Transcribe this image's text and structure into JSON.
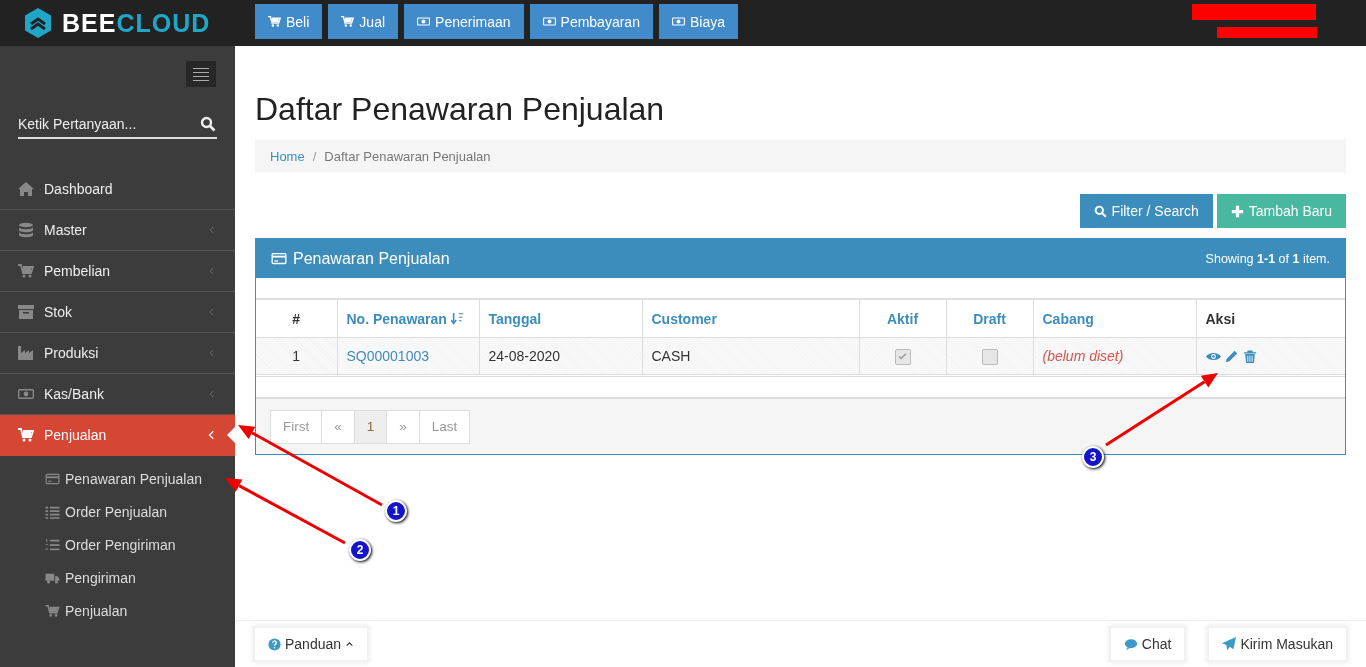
{
  "brand": {
    "name_part_1": "BEE",
    "name_part_2": "CLOUD"
  },
  "top_nav": [
    {
      "label": "Beli"
    },
    {
      "label": "Jual"
    },
    {
      "label": "Penerimaan"
    },
    {
      "label": "Pembayaran"
    },
    {
      "label": "Biaya"
    }
  ],
  "sidebar": {
    "search": {
      "placeholder": "Ketik Pertanyaan..."
    },
    "items": [
      {
        "label": "Dashboard",
        "has_submenu": false,
        "selected": false
      },
      {
        "label": "Master",
        "has_submenu": true,
        "selected": false
      },
      {
        "label": "Pembelian",
        "has_submenu": true,
        "selected": false
      },
      {
        "label": "Stok",
        "has_submenu": true,
        "selected": false
      },
      {
        "label": "Produksi",
        "has_submenu": true,
        "selected": false
      },
      {
        "label": "Kas/Bank",
        "has_submenu": true,
        "selected": false
      },
      {
        "label": "Penjualan",
        "has_submenu": true,
        "selected": true,
        "children": [
          {
            "label": "Penawaran Penjualan"
          },
          {
            "label": "Order Penjualan"
          },
          {
            "label": "Order Pengiriman"
          },
          {
            "label": "Pengiriman"
          },
          {
            "label": "Penjualan"
          }
        ]
      }
    ]
  },
  "page_title": "Daftar Penawaran Penjualan",
  "breadcrumb": {
    "separator": "/",
    "items": [
      {
        "label": "Home",
        "link": true
      },
      {
        "label": "Daftar Penawaran Penjualan",
        "link": false
      }
    ]
  },
  "actions": [
    {
      "label": "Filter / Search",
      "kind": "primary"
    },
    {
      "label": "Tambah Baru",
      "kind": "success"
    }
  ],
  "panel": {
    "title": "Penawaran Penjualan",
    "summary": "Showing **1-1** of **1** item.",
    "table": {
      "columns": [
        {
          "label": "#",
          "sortable": false,
          "link": false
        },
        {
          "label": "No. Penawaran",
          "sortable": true,
          "link": true
        },
        {
          "label": "Tanggal",
          "sortable": false,
          "link": true
        },
        {
          "label": "Customer",
          "sortable": false,
          "link": true
        },
        {
          "label": "Aktif",
          "sortable": false,
          "link": true
        },
        {
          "label": "Draft",
          "sortable": false,
          "link": true
        },
        {
          "label": "Cabang",
          "sortable": false,
          "link": true
        },
        {
          "label": "Aksi",
          "sortable": false,
          "link": false
        }
      ],
      "rows": [
        {
          "number": "1",
          "no_penawaran": "SQ00001003",
          "tanggal": "24-08-2020",
          "customer": "CASH",
          "aktif": true,
          "draft": false,
          "cabang": "(belum diset)"
        }
      ]
    },
    "pagination": [
      {
        "label": "First",
        "selected": false,
        "disabled": true
      },
      {
        "label": "«",
        "selected": false,
        "disabled": true
      },
      {
        "label": "1",
        "selected": true,
        "disabled": false
      },
      {
        "label": "»",
        "selected": false,
        "disabled": true
      },
      {
        "label": "Last",
        "selected": false,
        "disabled": true
      }
    ]
  },
  "footer": {
    "left": [
      {
        "label": "Panduan"
      }
    ],
    "right": [
      {
        "label": "Chat"
      },
      {
        "label": "Kirim Masukan"
      }
    ]
  },
  "annotations": [
    {
      "number": "1"
    },
    {
      "number": "2"
    },
    {
      "number": "3"
    }
  ]
}
